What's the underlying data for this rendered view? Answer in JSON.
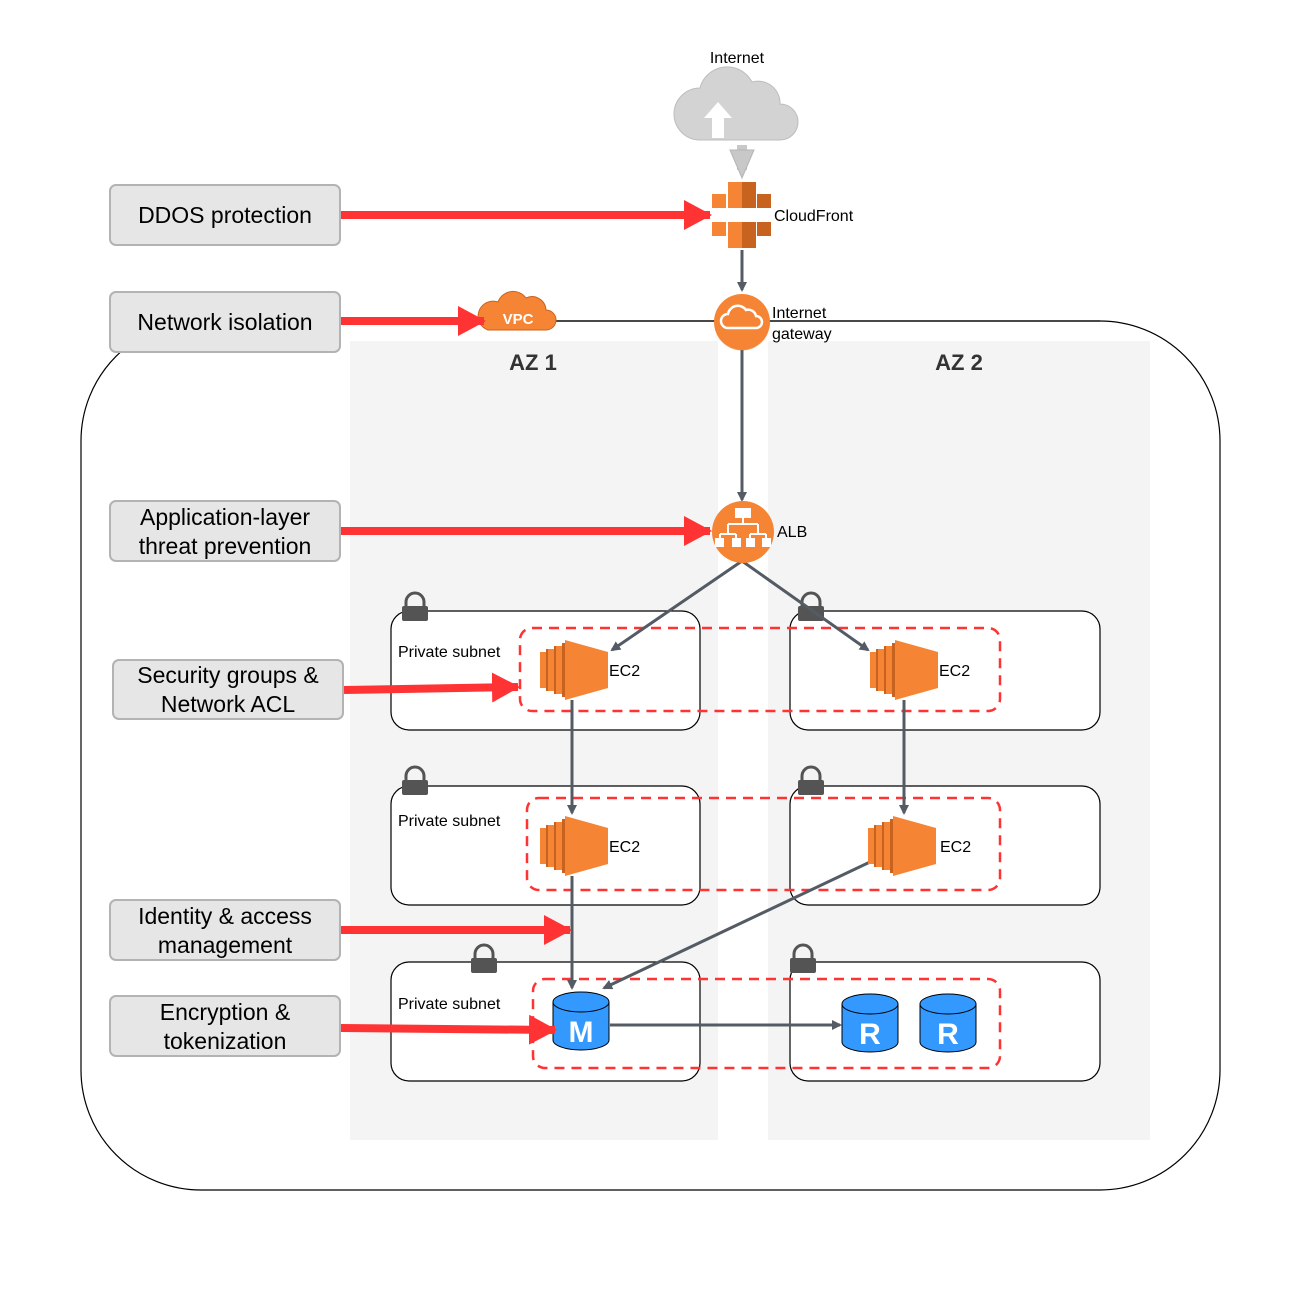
{
  "diagram": {
    "internet": {
      "label": "Internet"
    },
    "cloudfront": {
      "label": "CloudFront"
    },
    "vpc": {
      "label": "VPC"
    },
    "igw": {
      "label_line1": "Internet",
      "label_line2": "gateway"
    },
    "alb": {
      "label": "ALB"
    },
    "az1": {
      "label": "AZ 1"
    },
    "az2": {
      "label": "AZ 2"
    },
    "subnets": [
      {
        "label": "Private subnet"
      },
      {
        "label": "Private subnet"
      },
      {
        "label": "Private subnet"
      }
    ],
    "ec2": [
      {
        "label": "EC2"
      },
      {
        "label": "EC2"
      },
      {
        "label": "EC2"
      },
      {
        "label": "EC2"
      }
    ],
    "db_master": {
      "label": "M"
    },
    "db_replicas": [
      {
        "label": "R"
      },
      {
        "label": "R"
      }
    ],
    "callouts": [
      {
        "lines": [
          "DDOS protection"
        ]
      },
      {
        "lines": [
          "Network isolation"
        ]
      },
      {
        "lines": [
          "Application-layer",
          "threat prevention"
        ]
      },
      {
        "lines": [
          "Security groups &",
          "Network ACL"
        ]
      },
      {
        "lines": [
          "Identity & access",
          "management"
        ]
      },
      {
        "lines": [
          "Encryption &",
          "tokenization"
        ]
      }
    ],
    "colors": {
      "aws_orange": "#F58534",
      "aws_orange_dark": "#C8631F",
      "security_red": "#FF3333",
      "arrow_gray": "#545B64",
      "db_blue": "#3399FF",
      "az_fill": "#F4F4F4",
      "callout_fill": "#E6E6E6",
      "cloud_gray": "#D3D3D3"
    }
  }
}
